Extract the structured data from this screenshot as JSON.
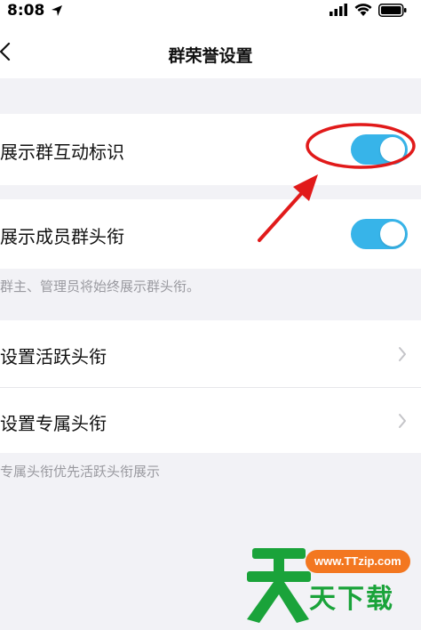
{
  "status_bar": {
    "time": "8:08"
  },
  "nav": {
    "title": "群荣誉设置"
  },
  "rows": {
    "interactive_badge": {
      "label": "展示群互动标识",
      "toggle_on": true
    },
    "member_title": {
      "label": "展示成员群头衔",
      "toggle_on": true
    },
    "active_title": {
      "label": "设置活跃头衔"
    },
    "exclusive_title": {
      "label": "设置专属头衔"
    }
  },
  "notes": {
    "member_title_note": "群主、管理员将始终展示群头衔。",
    "exclusive_note": "专属头衔优先活跃头衔展示"
  },
  "colors": {
    "toggle_on": "#37b4e9",
    "annotation": "#e11a1a",
    "watermark_green": "#1aa33a",
    "watermark_orange": "#f37720"
  },
  "watermark": {
    "url": "www.TTzip.com",
    "text": "天下载"
  }
}
